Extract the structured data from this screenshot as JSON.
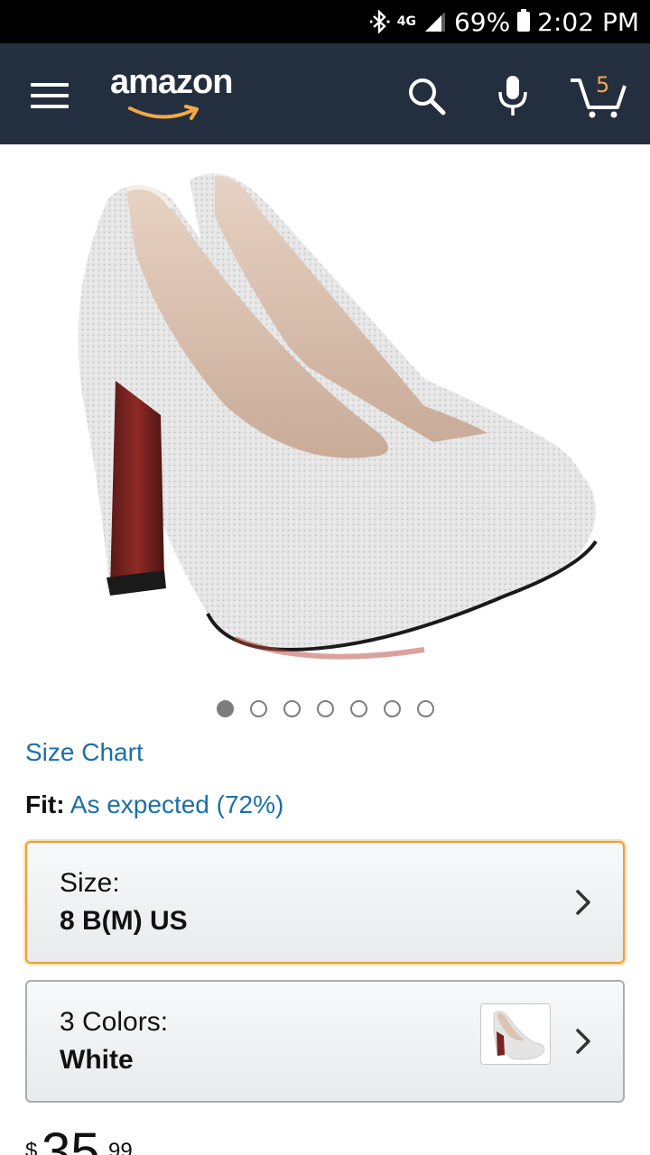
{
  "status_bar": {
    "network": "4G",
    "battery": "69%",
    "time": "2:02 PM"
  },
  "header": {
    "logo": "amazon",
    "cart_count": "5",
    "icons": [
      "menu-icon",
      "search-icon",
      "microphone-icon",
      "cart-icon"
    ]
  },
  "product": {
    "image_alt": "white glitter platform high heel pumps with red sole",
    "carousel": {
      "total": 7,
      "active": 1
    },
    "size_chart_link": "Size Chart",
    "fit": {
      "label": "Fit:",
      "value": "As expected (72%)"
    },
    "size": {
      "label": "Size:",
      "value": "8 B(M) US"
    },
    "color": {
      "label": "3 Colors:",
      "value": "White"
    },
    "price": {
      "currency": "$",
      "whole": "35",
      "fraction": "99"
    }
  },
  "colors": {
    "header_bg": "#232f3e",
    "link": "#1b6fa8",
    "size_box_border": "#e8a23b",
    "cart_count": "#f3a847"
  }
}
